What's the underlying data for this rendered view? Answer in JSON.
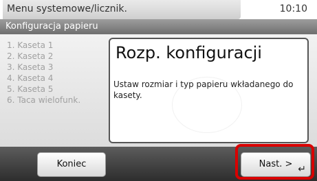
{
  "status": {
    "title": "Menu systemowe/licznik.",
    "time": "10:10"
  },
  "subtitle": "Konfiguracja papieru",
  "steps": [
    "1. Kaseta 1",
    "2. Kaseta 2",
    "3. Kaseta 3",
    "4. Kaseta 4",
    "5. Kaseta 5",
    "6. Taca wielofunk."
  ],
  "panel": {
    "heading": "Rozp. konfiguracji",
    "description": "Ustaw rozmiar i typ papieru wkładanego do kasety."
  },
  "buttons": {
    "end": "Koniec",
    "next": "Nast. >"
  },
  "icons": {
    "enter": "enter-icon"
  },
  "colors": {
    "highlight": "#d90000"
  }
}
